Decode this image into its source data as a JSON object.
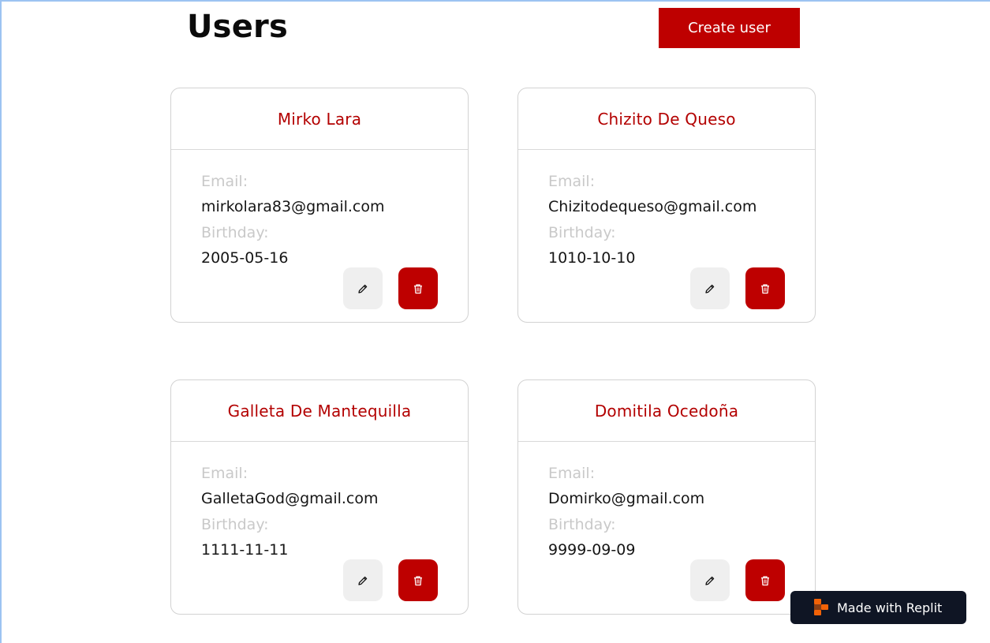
{
  "page": {
    "title": "Users",
    "create_button_label": "Create user"
  },
  "users": [
    {
      "name": "Mirko Lara",
      "email_label": "Email:",
      "email": "mirkolara83@gmail.com",
      "birthday_label": "Birthday:",
      "birthday": "2005-05-16"
    },
    {
      "name": "Chizito De Queso",
      "email_label": "Email:",
      "email": "Chizitodequeso@gmail.com",
      "birthday_label": "Birthday:",
      "birthday": "1010-10-10"
    },
    {
      "name": "Galleta De Mantequilla",
      "email_label": "Email:",
      "email": "GalletaGod@gmail.com",
      "birthday_label": "Birthday:",
      "birthday": "1111-11-11"
    },
    {
      "name": "Domitila Ocedoña",
      "email_label": "Email:",
      "email": "Domirko@gmail.com",
      "birthday_label": "Birthday:",
      "birthday": "9999-09-09"
    }
  ],
  "actions": {
    "edit_icon": "pencil-icon",
    "delete_icon": "trash-icon"
  },
  "badge": {
    "label": "Made with Replit",
    "icon": "replit-logo-icon"
  },
  "colors": {
    "accent": "#be0000",
    "name_text": "#b30000",
    "label_text": "#c9c9c9",
    "edit_button_bg": "#efefef",
    "badge_bg": "#0f1524",
    "replit_orange": "#f26207"
  }
}
